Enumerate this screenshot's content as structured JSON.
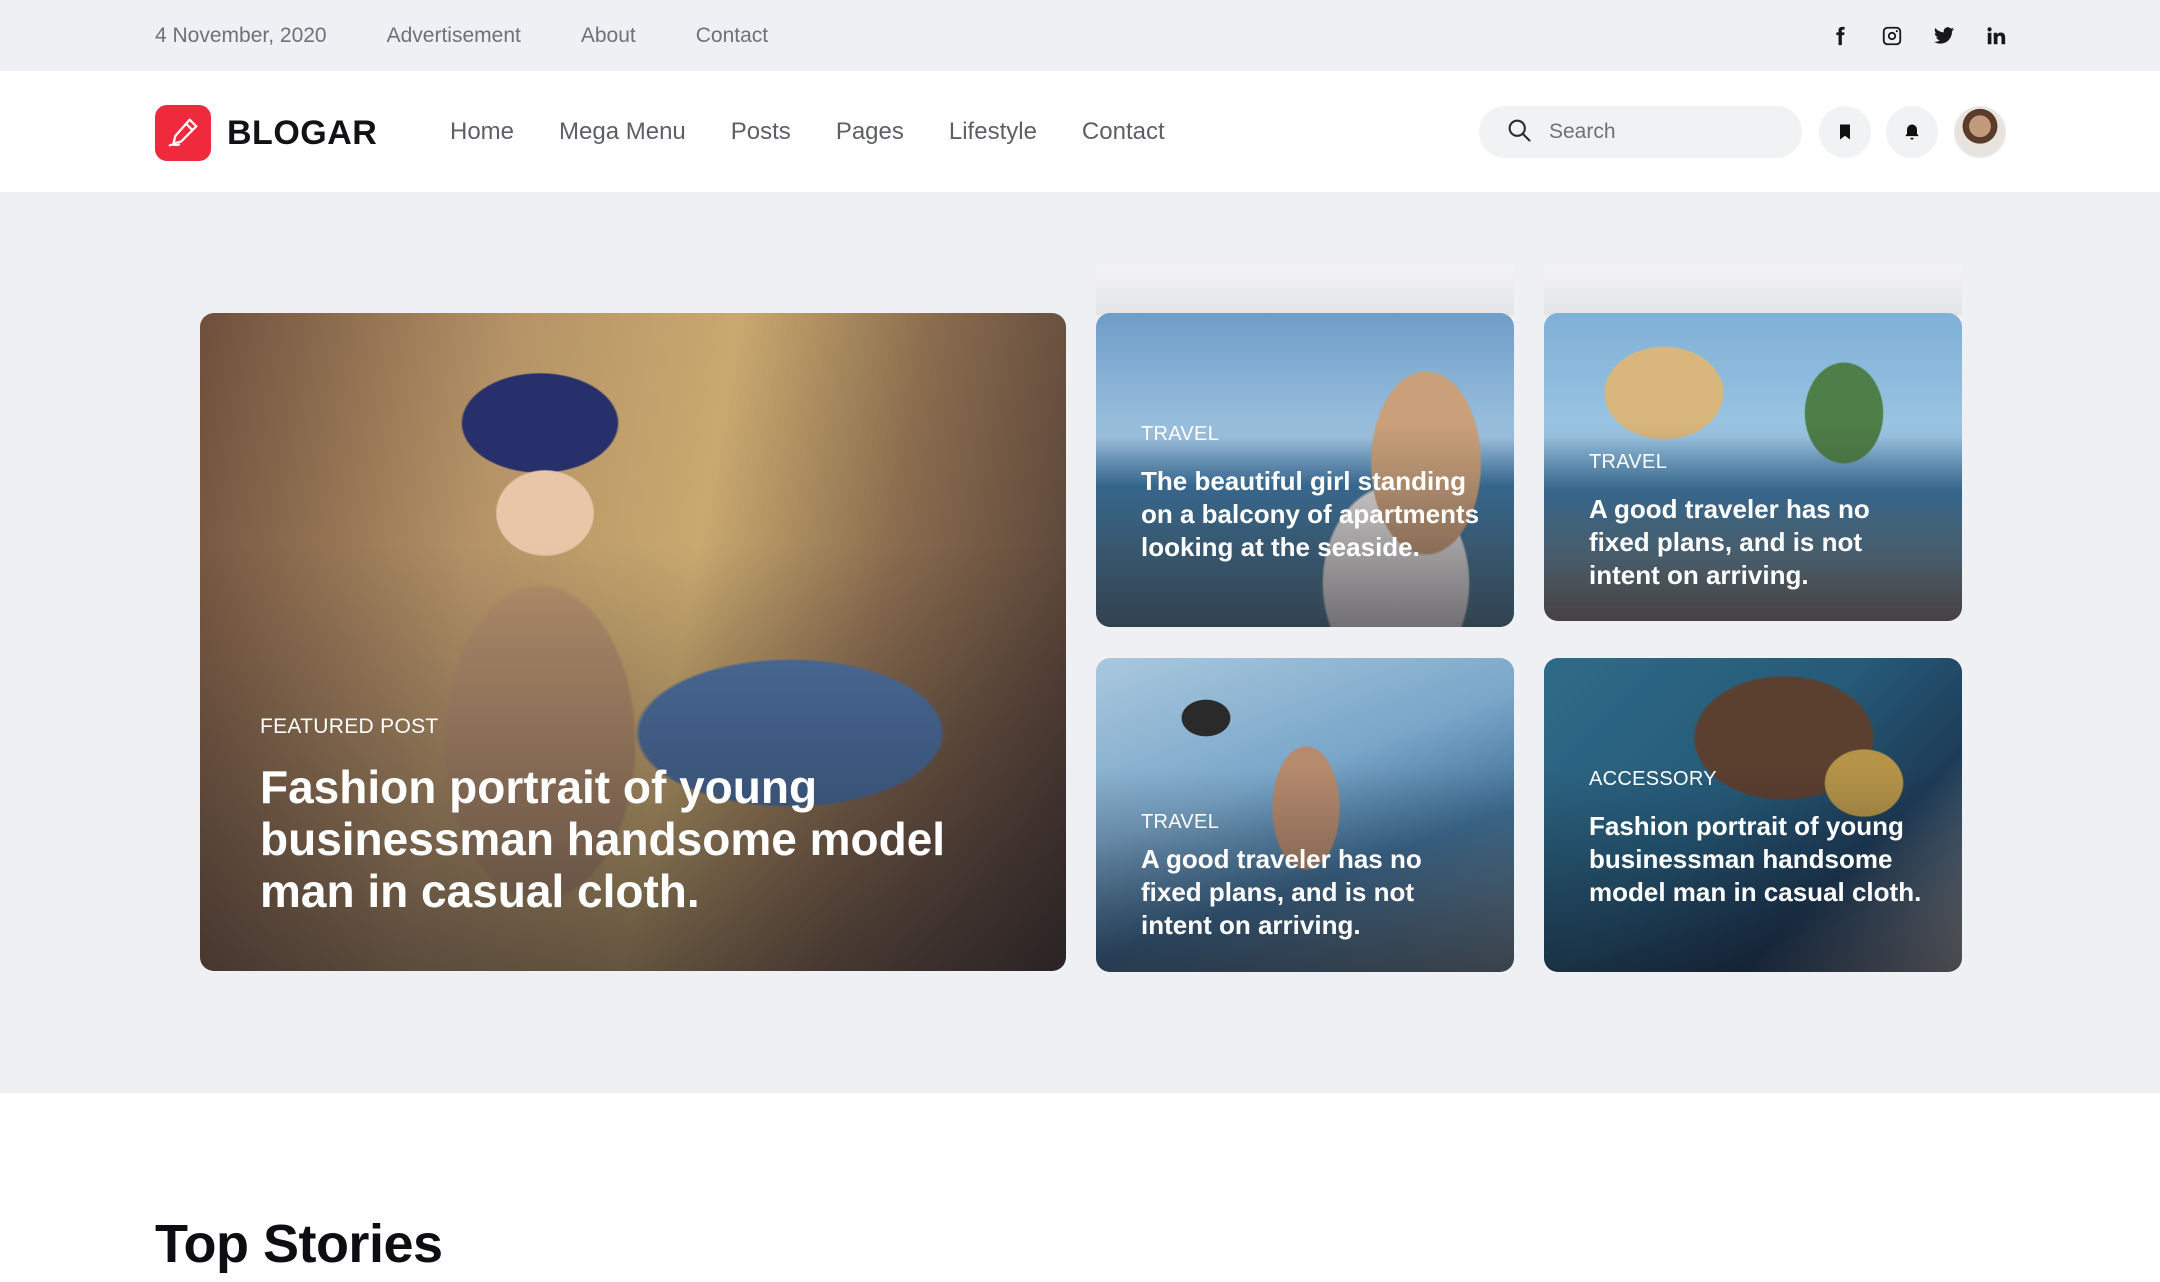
{
  "topbar": {
    "date": "4 November, 2020",
    "links": [
      "Advertisement",
      "About",
      "Contact"
    ],
    "social": [
      "facebook-icon",
      "instagram-icon",
      "twitter-icon",
      "linkedin-icon"
    ]
  },
  "header": {
    "brand": "BLOGAR",
    "brand_color": "#ee2a3c",
    "nav": [
      "Home",
      "Mega Menu",
      "Posts",
      "Pages",
      "Lifestyle",
      "Contact"
    ],
    "search_placeholder": "Search"
  },
  "hero": {
    "featured": {
      "category": "FEATURED POST",
      "title": "Fashion portrait of young businessman handsome model man in casual cloth."
    },
    "cards": [
      {
        "category": "TRAVEL",
        "title": "The beautiful girl standing on a balcony of apartments looking at the seaside."
      },
      {
        "category": "TRAVEL",
        "title": "A good traveler has no fixed plans, and is not intent on arriving."
      },
      {
        "category": "TRAVEL",
        "title": "A good traveler has no fixed plans, and is not intent on arriving."
      },
      {
        "category": "ACCESSORY",
        "title": "Fashion portrait of young businessman handsome model man in casual cloth."
      }
    ]
  },
  "sections": {
    "top_stories": "Top Stories"
  }
}
